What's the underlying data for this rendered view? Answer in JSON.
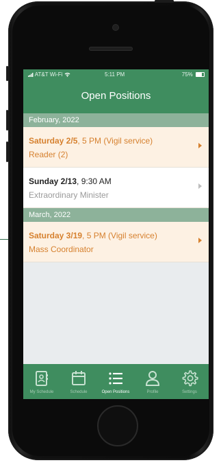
{
  "status_bar": {
    "carrier": "AT&T Wi-Fi",
    "time": "5:11 PM",
    "battery": "75%"
  },
  "header": {
    "title": "Open Positions"
  },
  "sections": [
    {
      "month": "February, 2022",
      "items": [
        {
          "day": "Saturday 2/5",
          "time": ", 5 PM (Vigil service)",
          "role": "Reader (2)",
          "state": "open"
        },
        {
          "day": "Sunday 2/13",
          "time": ", 9:30 AM",
          "role": "Extraordinary Minister",
          "state": "plain"
        }
      ]
    },
    {
      "month": "March, 2022",
      "items": [
        {
          "day": "Saturday 3/19",
          "time": ", 5 PM (Vigil service)",
          "role": "Mass Coordinator",
          "state": "open"
        }
      ]
    }
  ],
  "tabs": [
    {
      "label": "My Schedule",
      "icon": "my-schedule-icon"
    },
    {
      "label": "Schedule",
      "icon": "calendar-icon"
    },
    {
      "label": "Open Positions",
      "icon": "list-icon",
      "active": true
    },
    {
      "label": "Profile",
      "icon": "profile-icon"
    },
    {
      "label": "Settings",
      "icon": "gear-icon"
    }
  ],
  "colors": {
    "brand_green": "#3f8d5f",
    "section_green": "#8db29a",
    "open_orange": "#d6812f",
    "open_row_bg": "#fdf1e3"
  }
}
